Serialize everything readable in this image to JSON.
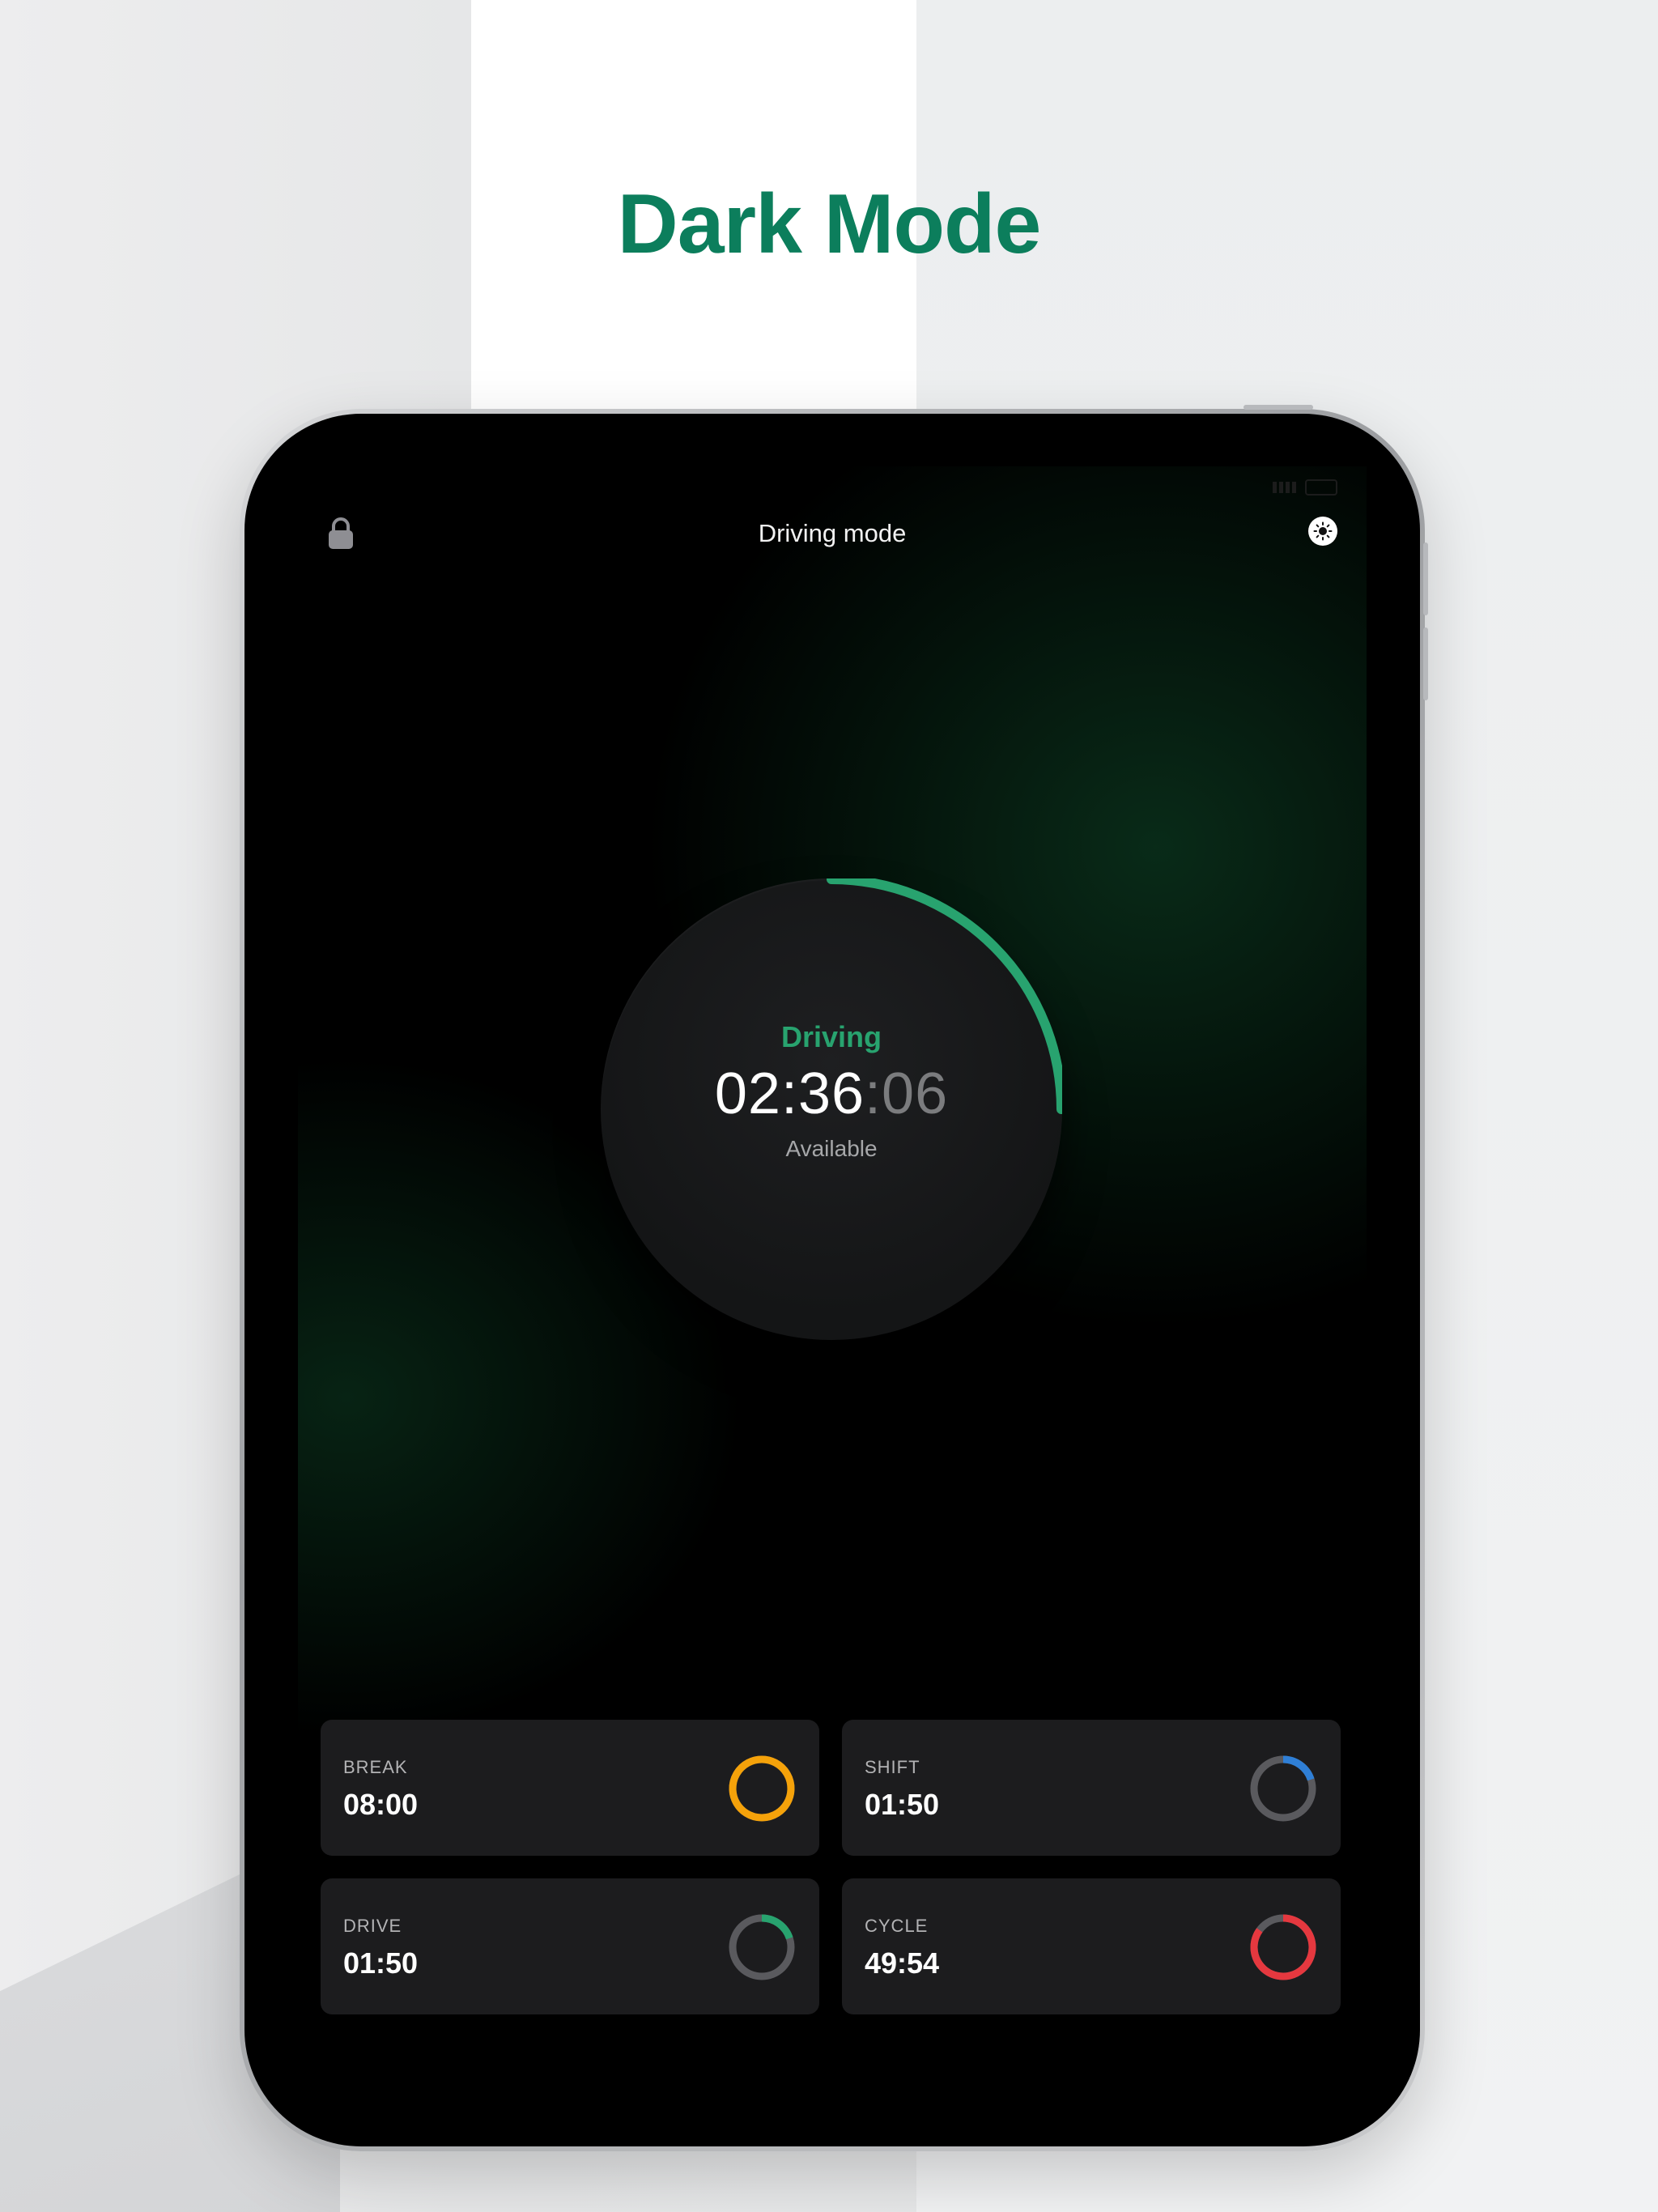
{
  "headline": "Dark Mode",
  "app": {
    "title": "Driving mode",
    "lock_icon": "lock-icon",
    "theme_icon": "sun-icon"
  },
  "dial": {
    "state": "Driving",
    "time_main": "02:36",
    "time_seconds": ":06",
    "subtitle": "Available",
    "progress": 0.25,
    "accent": "#28a36f"
  },
  "cards": [
    {
      "label": "BREAK",
      "value": "08:00",
      "color": "#f5a20a",
      "progress": 1.0
    },
    {
      "label": "SHIFT",
      "value": "01:50",
      "color": "#2f7fd6",
      "progress": 0.2
    },
    {
      "label": "DRIVE",
      "value": "01:50",
      "color": "#28a36f",
      "progress": 0.2
    },
    {
      "label": "CYCLE",
      "value": "49:54",
      "color": "#e5383f",
      "progress": 0.85
    }
  ]
}
